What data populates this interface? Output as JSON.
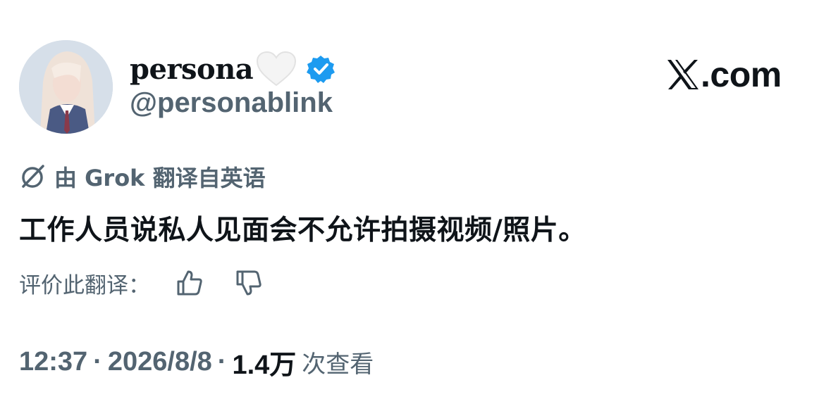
{
  "author": {
    "display_name": "persona",
    "handle": "@personablink",
    "heart_icon": "white-heart-icon",
    "verified_icon": "verified-badge-icon"
  },
  "brand": {
    "logo_icon": "x-logo-icon",
    "domain_suffix": ".com"
  },
  "translation": {
    "icon": "translate-icon",
    "label": "由 Grok 翻译自英语"
  },
  "tweet": {
    "text": "工作人员说私人见面会不允许拍摄视频/照片。"
  },
  "rating": {
    "label": "评价此翻译：",
    "thumbs_up_icon": "thumbs-up-icon",
    "thumbs_down_icon": "thumbs-down-icon"
  },
  "meta": {
    "time": "12:37",
    "separator": "·",
    "date": "2026/8/8",
    "views_count": "1.4万",
    "views_label": "次查看"
  },
  "colors": {
    "primary_text": "#0f1419",
    "secondary_text": "#536471",
    "verified_blue": "#1d9bf0",
    "background": "#ffffff"
  }
}
